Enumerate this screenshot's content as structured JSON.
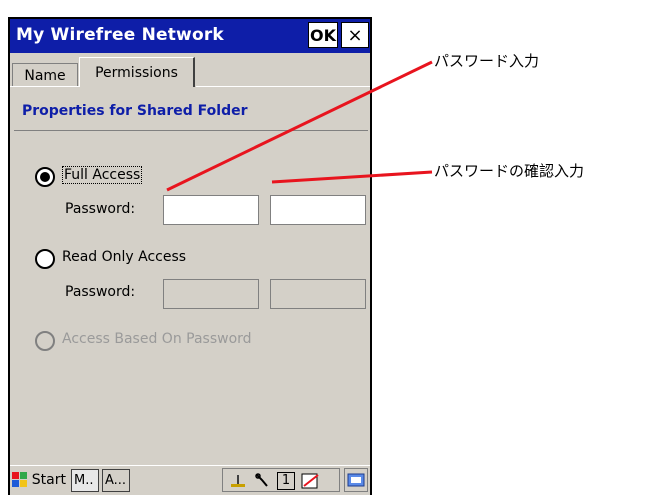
{
  "window": {
    "title": "My Wirefree Network",
    "ok_label": "OK",
    "close_label": "×"
  },
  "tabs": [
    {
      "label": "Name",
      "selected": false
    },
    {
      "label": "Permissions",
      "selected": true
    }
  ],
  "section": {
    "heading": "Properties for Shared Folder"
  },
  "options": [
    {
      "label": "Full Access",
      "checked": true,
      "enabled": true,
      "password_label": "Password:",
      "password_value": "",
      "confirm_value": ""
    },
    {
      "label": "Read Only Access",
      "checked": false,
      "enabled": true,
      "password_label": "Password:",
      "password_value": "",
      "confirm_value": ""
    },
    {
      "label": "Access Based On Password",
      "checked": false,
      "enabled": false
    }
  ],
  "taskbar": {
    "start_label": "Start",
    "tasks": [
      "M..",
      "A..."
    ],
    "tray_number": "1"
  },
  "annotations": {
    "password_input": "パスワード入力",
    "password_confirm": "パスワードの確認入力"
  },
  "colors": {
    "titlebar": "#0e1ea8",
    "heading": "#0e1ea8",
    "dialog_bg": "#d4d0c8",
    "callout_line": "#e8141e"
  }
}
